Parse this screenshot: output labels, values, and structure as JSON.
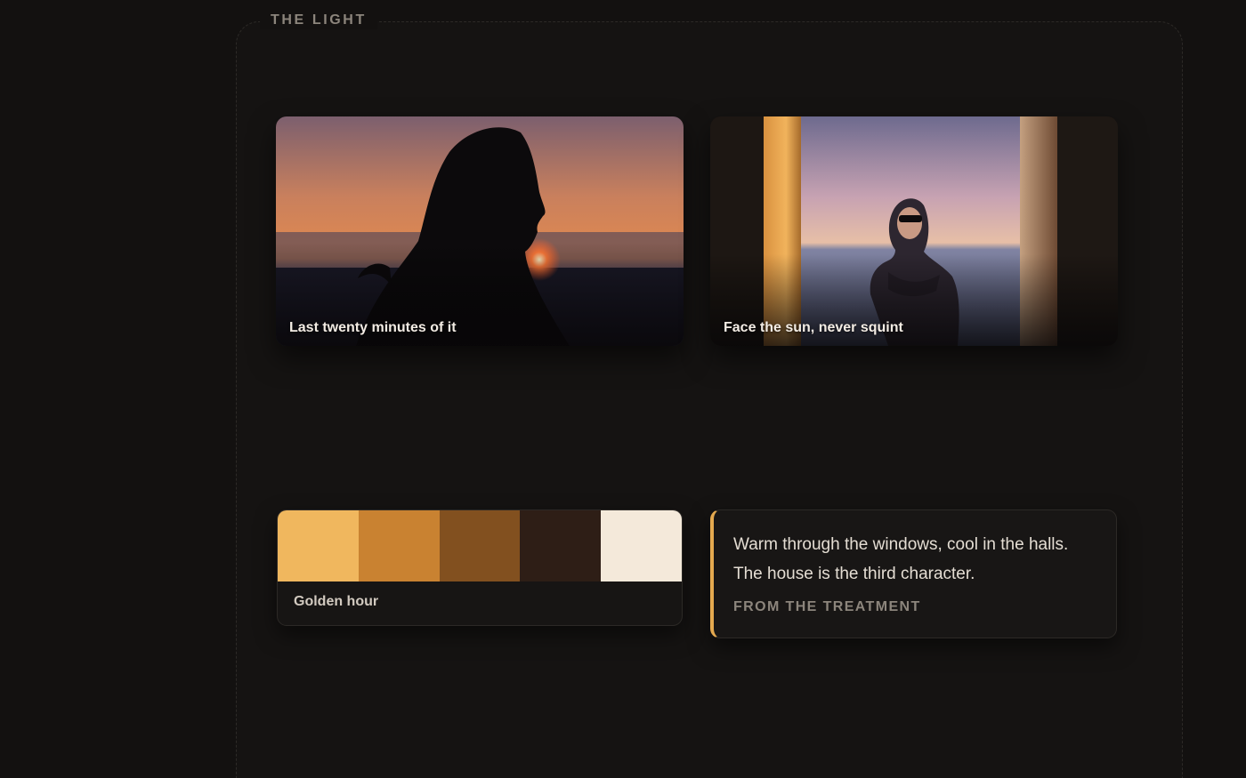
{
  "section": {
    "label": "THE LIGHT"
  },
  "stills": [
    {
      "caption": "Last twenty minutes of it",
      "subject": "woman silhouette at sunset over sea"
    },
    {
      "caption": "Face the sun, never squint",
      "subject": "woman in sunglasses between columns by the sea"
    }
  ],
  "palette": {
    "name": "Golden hour",
    "colors": [
      "#f0b75e",
      "#c98231",
      "#82501f",
      "#2e1e16",
      "#f4e9da"
    ]
  },
  "quote": {
    "text": "Warm through the windows, cool in the halls. The house is the third character.",
    "source": "FROM THE TREATMENT",
    "accent": "#e4a94f"
  }
}
